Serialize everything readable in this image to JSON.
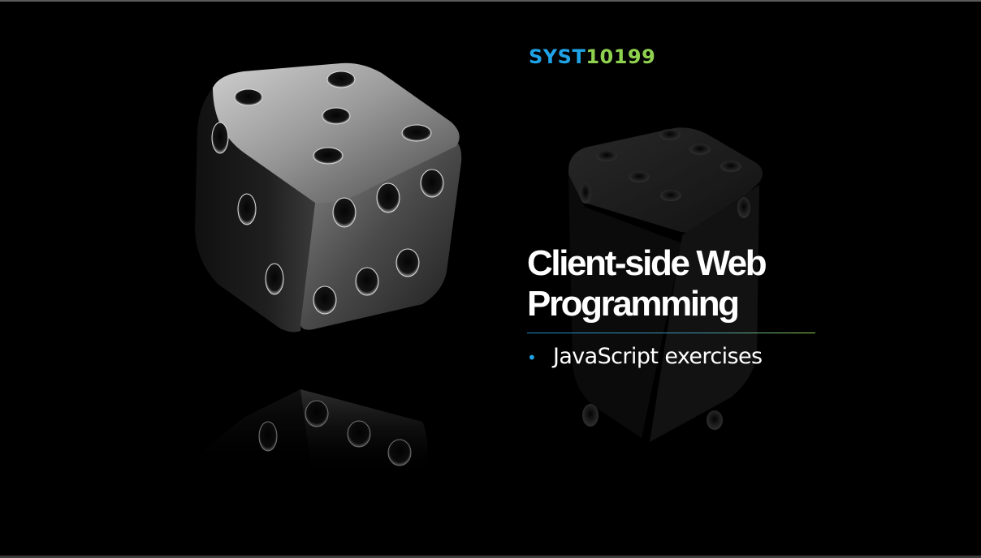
{
  "slide": {
    "course_code_part_a": "SYST",
    "course_code_part_b": "10199",
    "title_line_1": "Client-side Web",
    "title_line_2": "Programming",
    "bullets": [
      {
        "marker": "•",
        "text": "JavaScript exercises"
      }
    ]
  },
  "colors": {
    "background": "#000000",
    "accent_blue": "#1fa3e6",
    "accent_green": "#8fd14f",
    "title_text": "#ffffff"
  },
  "icons": {
    "illustration": "dice-icon"
  }
}
